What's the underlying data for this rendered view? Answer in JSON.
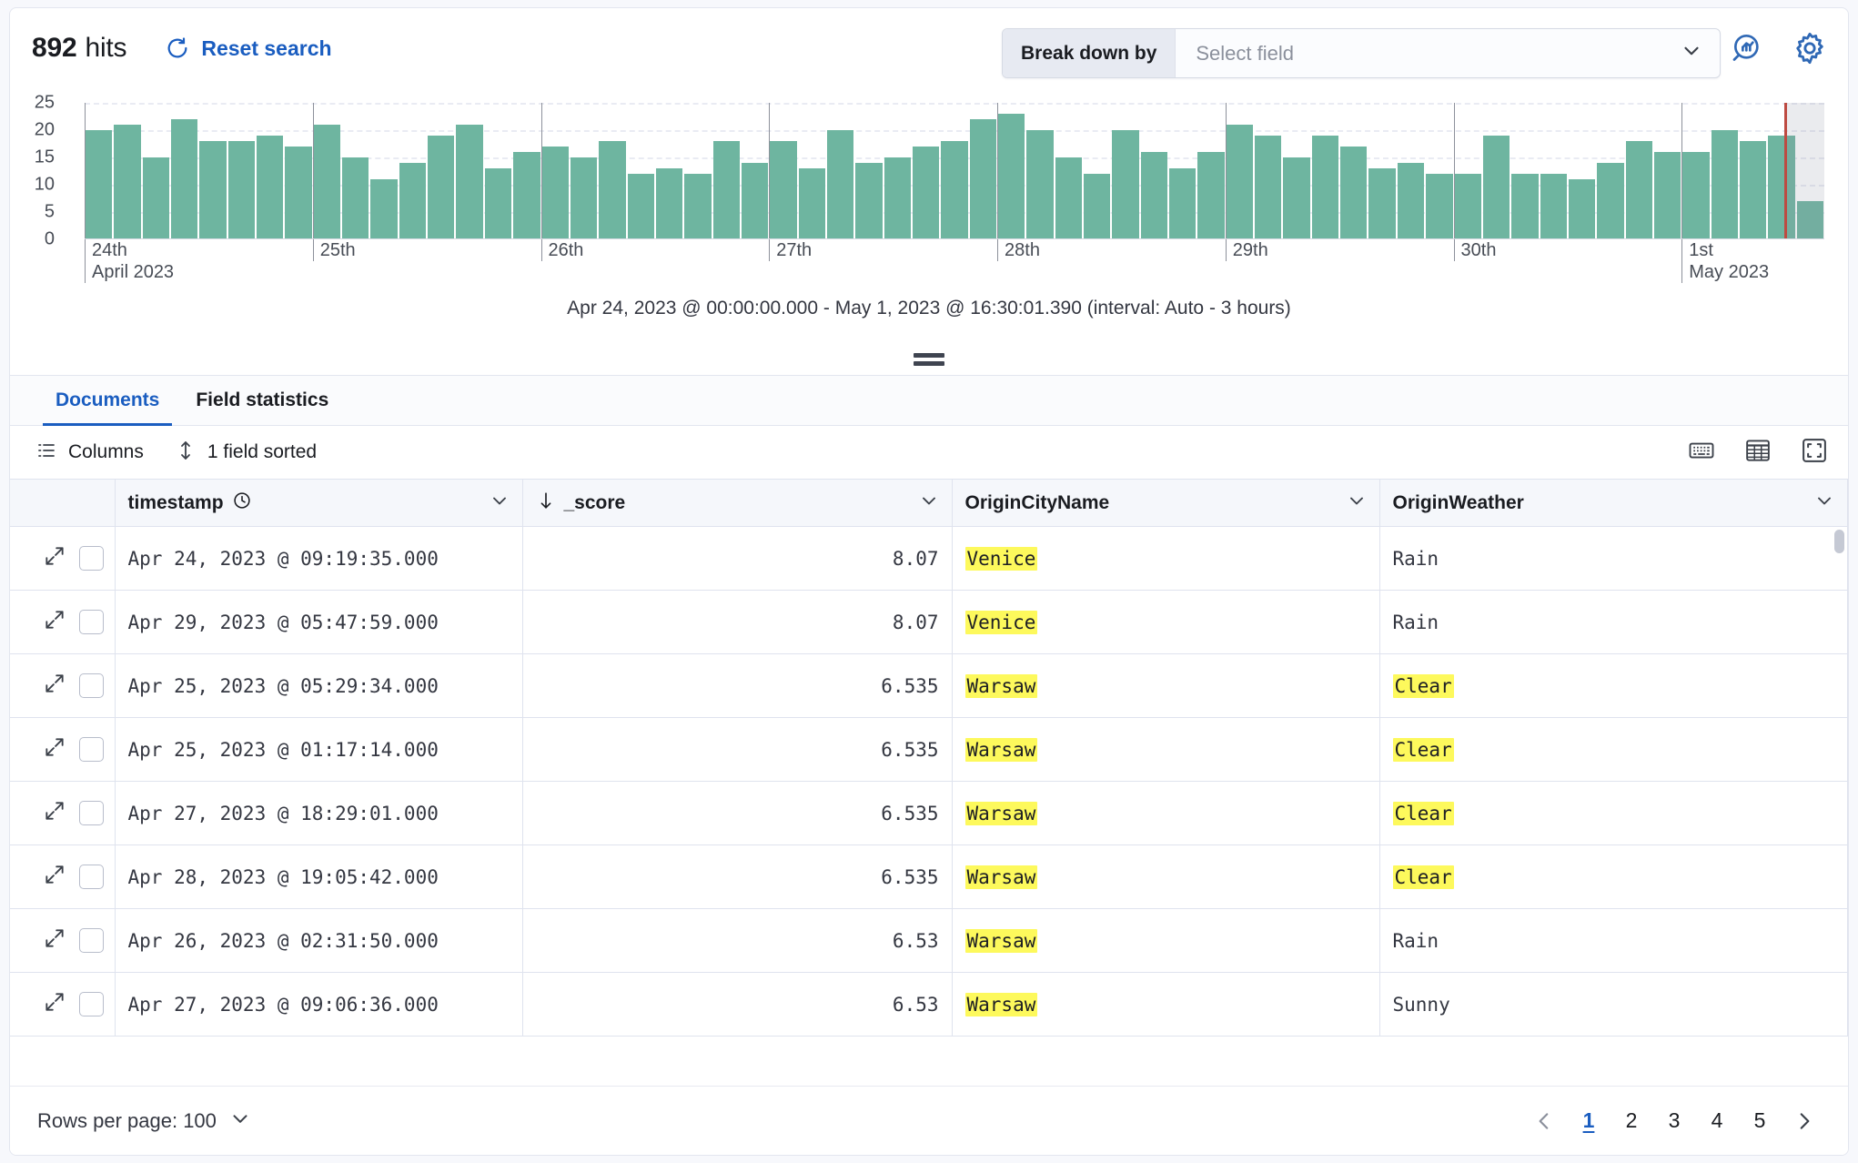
{
  "header": {
    "hits_count": "892",
    "hits_label": "hits",
    "reset_label": "Reset search",
    "reset_icon": "refresh-icon",
    "breakdown_label": "Break down by",
    "breakdown_value": "",
    "breakdown_placeholder": "Select field",
    "inspect_icon": "inspect-lens-icon",
    "settings_icon": "gear-icon"
  },
  "chart_data": {
    "type": "bar",
    "title": "",
    "xlabel": "",
    "ylabel": "",
    "ylim": [
      0,
      25
    ],
    "yticks": [
      0,
      5,
      10,
      15,
      20,
      25
    ],
    "gridlines": [
      5,
      10,
      15,
      20,
      25
    ],
    "grid": true,
    "bar_color": "#6eb5a0",
    "interval": "Auto - 3 hours",
    "time_range_caption": "Apr 24, 2023 @ 00:00:00.000 - May 1, 2023 @ 16:30:01.390 (interval: Auto - 3 hours)",
    "xtick_labels": [
      {
        "primary": "24th",
        "secondary": "April 2023",
        "bucket": 0
      },
      {
        "primary": "25th",
        "secondary": "",
        "bucket": 8
      },
      {
        "primary": "26th",
        "secondary": "",
        "bucket": 16
      },
      {
        "primary": "27th",
        "secondary": "",
        "bucket": 24
      },
      {
        "primary": "28th",
        "secondary": "",
        "bucket": 32
      },
      {
        "primary": "29th",
        "secondary": "",
        "bucket": 40
      },
      {
        "primary": "30th",
        "secondary": "",
        "bucket": 48
      },
      {
        "primary": "1st",
        "secondary": "May 2023",
        "bucket": 56
      }
    ],
    "values": [
      20,
      21,
      15,
      22,
      18,
      18,
      19,
      17,
      21,
      15,
      11,
      14,
      19,
      21,
      13,
      16,
      17,
      15,
      18,
      12,
      13,
      12,
      18,
      14,
      18,
      13,
      20,
      14,
      15,
      17,
      18,
      22,
      23,
      20,
      15,
      12,
      20,
      16,
      13,
      16,
      21,
      19,
      15,
      19,
      17,
      13,
      14,
      12,
      12,
      19,
      12,
      12,
      11,
      14,
      18,
      16,
      16,
      20,
      18,
      19,
      7
    ],
    "annotations": [
      {
        "name": "current-time-marker",
        "color": "#bd4b42",
        "bucket": 59.6
      },
      {
        "name": "partial-bucket-shading",
        "from_bucket": 59.7,
        "to_bucket": 61
      }
    ]
  },
  "resize_handle": "chart-resize-handle",
  "tabs": [
    {
      "label": "Documents",
      "active": true,
      "name": "tab-documents"
    },
    {
      "label": "Field statistics",
      "active": false,
      "name": "tab-field-statistics"
    }
  ],
  "toolbar": {
    "columns_label": "Columns",
    "columns_icon": "list-icon",
    "sorted_label": "1 field sorted",
    "sorted_icon": "sort-icon",
    "keyboard_icon": "keyboard-shortcuts-icon",
    "density_icon": "table-density-icon",
    "fullscreen_icon": "fullscreen-icon"
  },
  "table": {
    "columns": [
      {
        "key": "timestamp",
        "label": "timestamp",
        "icon": "clock-icon",
        "sorted": false,
        "align": "left"
      },
      {
        "key": "_score",
        "label": "_score",
        "icon": "sort-desc-arrow-icon",
        "sorted": true,
        "align": "right"
      },
      {
        "key": "OriginCityName",
        "label": "OriginCityName",
        "icon": "",
        "sorted": false,
        "align": "left"
      },
      {
        "key": "OriginWeather",
        "label": "OriginWeather",
        "icon": "",
        "sorted": false,
        "align": "left"
      }
    ],
    "highlight_color": "#fdf95c",
    "rows": [
      {
        "timestamp": "Apr 24, 2023 @ 09:19:35.000",
        "score": "8.07",
        "city": "Venice",
        "city_hl": true,
        "weather": "Rain",
        "weather_hl": false
      },
      {
        "timestamp": "Apr 29, 2023 @ 05:47:59.000",
        "score": "8.07",
        "city": "Venice",
        "city_hl": true,
        "weather": "Rain",
        "weather_hl": false
      },
      {
        "timestamp": "Apr 25, 2023 @ 05:29:34.000",
        "score": "6.535",
        "city": "Warsaw",
        "city_hl": true,
        "weather": "Clear",
        "weather_hl": true
      },
      {
        "timestamp": "Apr 25, 2023 @ 01:17:14.000",
        "score": "6.535",
        "city": "Warsaw",
        "city_hl": true,
        "weather": "Clear",
        "weather_hl": true
      },
      {
        "timestamp": "Apr 27, 2023 @ 18:29:01.000",
        "score": "6.535",
        "city": "Warsaw",
        "city_hl": true,
        "weather": "Clear",
        "weather_hl": true
      },
      {
        "timestamp": "Apr 28, 2023 @ 19:05:42.000",
        "score": "6.535",
        "city": "Warsaw",
        "city_hl": true,
        "weather": "Clear",
        "weather_hl": true
      },
      {
        "timestamp": "Apr 26, 2023 @ 02:31:50.000",
        "score": "6.53",
        "city": "Warsaw",
        "city_hl": true,
        "weather": "Rain",
        "weather_hl": false
      },
      {
        "timestamp": "Apr 27, 2023 @ 09:06:36.000",
        "score": "6.53",
        "city": "Warsaw",
        "city_hl": true,
        "weather": "Sunny",
        "weather_hl": false
      }
    ]
  },
  "footer": {
    "rows_per_page_label": "Rows per page: 100",
    "pages": [
      "1",
      "2",
      "3",
      "4",
      "5"
    ],
    "active_page": "1",
    "prev_icon": "chevron-left-icon",
    "next_icon": "chevron-right-icon"
  }
}
